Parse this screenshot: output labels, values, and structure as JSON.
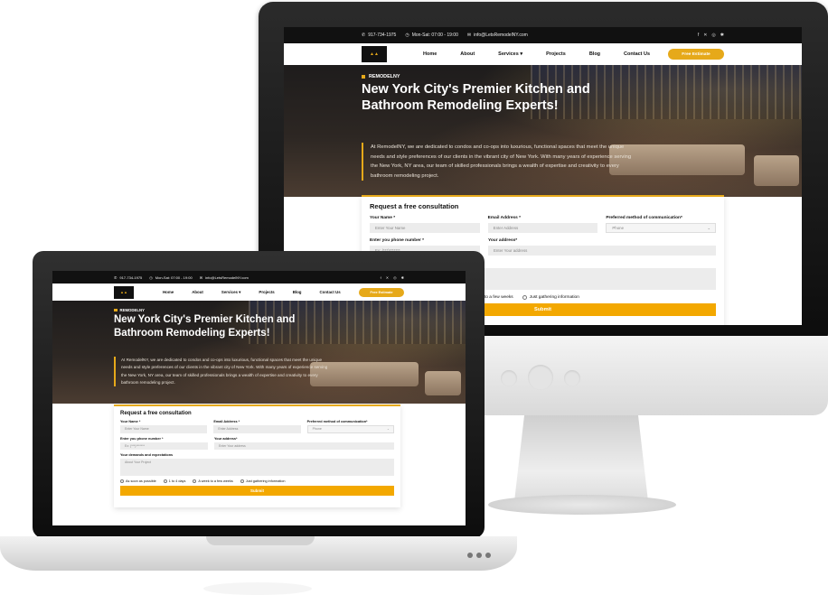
{
  "site": {
    "topbar": {
      "phone": "917-734-1975",
      "hours": "Mon-Sat: 07:00 - 19:00",
      "email": "info@LetsRemodelNY.com",
      "social_icons": [
        "facebook-icon",
        "x-icon",
        "instagram-icon",
        "yelp-icon"
      ]
    },
    "nav": {
      "items": [
        "Home",
        "About",
        "Services ▾",
        "Projects",
        "Blog",
        "Contact Us"
      ],
      "cta": "Free Estimate"
    },
    "hero": {
      "tag": "REMODELNY",
      "title": "New York City's Premier Kitchen and Bathroom Remodeling Experts!",
      "description": "At RemodelNY, we are dedicated to condos and co-ops into luxurious, functional spaces that meet the unique needs and style preferences of our clients in the vibrant city of New York. With many years of experience serving the New York, NY area, our team of skilled professionals brings a wealth of expertise and creativity to every bathroom remodeling project."
    },
    "form": {
      "title": "Request a free consultation",
      "name_label": "Your Name *",
      "name_placeholder": "Enter Your Name",
      "email_label": "Email Address *",
      "email_placeholder": "Enter Address",
      "method_label": "Preferred method of communication*",
      "method_value": "Phone",
      "phone_label": "Enter you phone number *",
      "phone_placeholder": "Ex: (***)*******",
      "address_label": "Your address*",
      "address_placeholder": "Enter Your address",
      "demands_label": "Your demands and expectations",
      "demands_placeholder": "About Your Project",
      "radios": [
        "As soon as possible",
        "1 to 4 days",
        "A week to a few weeks",
        "Just gathering information"
      ],
      "submit": "Submit"
    }
  },
  "colors": {
    "accent": "#e6a91a",
    "submit": "#f3a800",
    "topbar": "#111111"
  }
}
